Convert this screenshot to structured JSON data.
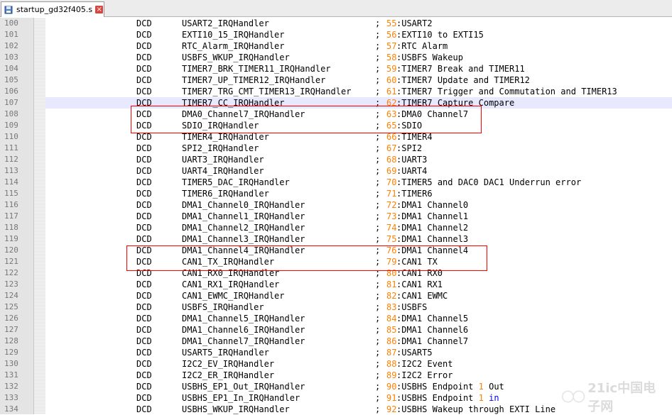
{
  "tab": {
    "filename": "startup_gd32f405.s",
    "icon": "file-icon",
    "close_icon": "close-icon"
  },
  "colors": {
    "accent_number": "#ff8000",
    "keyword": "#0000ff",
    "highlight_box": "#ff0000",
    "current_line": "#e8e8ff"
  },
  "editor": {
    "current_line": "107",
    "rows": [
      {
        "ln": "100",
        "dir": "DCD",
        "handler": "USART2_IRQHandler",
        "semi": ";",
        "num": "55",
        "desc": ":USART2"
      },
      {
        "ln": "101",
        "dir": "DCD",
        "handler": "EXTI10_15_IRQHandler",
        "semi": ";",
        "num": "56",
        "desc": ":EXTI10 to EXTI15"
      },
      {
        "ln": "102",
        "dir": "DCD",
        "handler": "RTC_Alarm_IRQHandler",
        "semi": ";",
        "num": "57",
        "desc": ":RTC Alarm"
      },
      {
        "ln": "103",
        "dir": "DCD",
        "handler": "USBFS_WKUP_IRQHandler",
        "semi": ";",
        "num": "58",
        "desc": ":USBFS Wakeup"
      },
      {
        "ln": "104",
        "dir": "DCD",
        "handler": "TIMER7_BRK_TIMER11_IRQHandler",
        "semi": ";",
        "num": "59",
        "desc": ":TIMER7 Break and TIMER11"
      },
      {
        "ln": "105",
        "dir": "DCD",
        "handler": "TIMER7_UP_TIMER12_IRQHandler",
        "semi": ";",
        "num": "60",
        "desc": ":TIMER7 Update and TIMER12"
      },
      {
        "ln": "106",
        "dir": "DCD",
        "handler": "TIMER7_TRG_CMT_TIMER13_IRQHandler",
        "semi": ";",
        "num": "61",
        "desc": ":TIMER7 Trigger and Commutation and TIMER13"
      },
      {
        "ln": "107",
        "dir": "DCD",
        "handler": "TIMER7_CC_IRQHandler",
        "semi": ";",
        "num": "62",
        "desc": ":TIMER7 Capture Compare"
      },
      {
        "ln": "108",
        "dir": "DCD",
        "handler": "DMA0_Channel7_IRQHandler",
        "semi": ";",
        "num": "63",
        "desc": ":DMA0 Channel7"
      },
      {
        "ln": "109",
        "dir": "DCD",
        "handler": "SDIO_IRQHandler",
        "semi": ";",
        "num": "65",
        "desc": ":SDIO"
      },
      {
        "ln": "110",
        "dir": "DCD",
        "handler": "TIMER4_IRQHandler",
        "semi": ";",
        "num": "66",
        "desc": ":TIMER4"
      },
      {
        "ln": "111",
        "dir": "DCD",
        "handler": "SPI2_IRQHandler",
        "semi": ";",
        "num": "67",
        "desc": ":SPI2"
      },
      {
        "ln": "112",
        "dir": "DCD",
        "handler": "UART3_IRQHandler",
        "semi": ";",
        "num": "68",
        "desc": ":UART3"
      },
      {
        "ln": "113",
        "dir": "DCD",
        "handler": "UART4_IRQHandler",
        "semi": ";",
        "num": "69",
        "desc": ":UART4"
      },
      {
        "ln": "114",
        "dir": "DCD",
        "handler": "TIMER5_DAC_IRQHandler",
        "semi": ";",
        "num": "70",
        "desc": ":TIMER5 and DAC0 DAC1 Underrun error"
      },
      {
        "ln": "115",
        "dir": "DCD",
        "handler": "TIMER6_IRQHandler",
        "semi": ";",
        "num": "71",
        "desc": ":TIMER6"
      },
      {
        "ln": "116",
        "dir": "DCD",
        "handler": "DMA1_Channel0_IRQHandler",
        "semi": ";",
        "num": "72",
        "desc": ":DMA1 Channel0"
      },
      {
        "ln": "117",
        "dir": "DCD",
        "handler": "DMA1_Channel1_IRQHandler",
        "semi": ";",
        "num": "73",
        "desc": ":DMA1 Channel1"
      },
      {
        "ln": "118",
        "dir": "DCD",
        "handler": "DMA1_Channel2_IRQHandler",
        "semi": ";",
        "num": "74",
        "desc": ":DMA1 Channel2"
      },
      {
        "ln": "119",
        "dir": "DCD",
        "handler": "DMA1_Channel3_IRQHandler",
        "semi": ";",
        "num": "75",
        "desc": ":DMA1 Channel3"
      },
      {
        "ln": "120",
        "dir": "DCD",
        "handler": "DMA1_Channel4_IRQHandler",
        "semi": ";",
        "num": "76",
        "desc": ":DMA1 Channel4"
      },
      {
        "ln": "121",
        "dir": "DCD",
        "handler": "CAN1_TX_IRQHandler",
        "semi": ";",
        "num": "79",
        "desc": ":CAN1 TX"
      },
      {
        "ln": "122",
        "dir": "DCD",
        "handler": "CAN1_RX0_IRQHandler",
        "semi": ";",
        "num": "80",
        "desc": ":CAN1 RX0"
      },
      {
        "ln": "123",
        "dir": "DCD",
        "handler": "CAN1_RX1_IRQHandler",
        "semi": ";",
        "num": "81",
        "desc": ":CAN1 RX1"
      },
      {
        "ln": "124",
        "dir": "DCD",
        "handler": "CAN1_EWMC_IRQHandler",
        "semi": ";",
        "num": "82",
        "desc": ":CAN1 EWMC"
      },
      {
        "ln": "125",
        "dir": "DCD",
        "handler": "USBFS_IRQHandler",
        "semi": ";",
        "num": "83",
        "desc": ":USBFS"
      },
      {
        "ln": "126",
        "dir": "DCD",
        "handler": "DMA1_Channel5_IRQHandler",
        "semi": ";",
        "num": "84",
        "desc": ":DMA1 Channel5"
      },
      {
        "ln": "127",
        "dir": "DCD",
        "handler": "DMA1_Channel6_IRQHandler",
        "semi": ";",
        "num": "85",
        "desc": ":DMA1 Channel6"
      },
      {
        "ln": "128",
        "dir": "DCD",
        "handler": "DMA1_Channel7_IRQHandler",
        "semi": ";",
        "num": "86",
        "desc": ":DMA1 Channel7"
      },
      {
        "ln": "129",
        "dir": "DCD",
        "handler": "USART5_IRQHandler",
        "semi": ";",
        "num": "87",
        "desc": ":USART5"
      },
      {
        "ln": "130",
        "dir": "DCD",
        "handler": "I2C2_EV_IRQHandler",
        "semi": ";",
        "num": "88",
        "desc": ":I2C2 Event"
      },
      {
        "ln": "131",
        "dir": "DCD",
        "handler": "I2C2_ER_IRQHandler",
        "semi": ";",
        "num": "89",
        "desc": ":I2C2 Error"
      },
      {
        "ln": "132",
        "dir": "DCD",
        "handler": "USBHS_EP1_Out_IRQHandler",
        "semi": ";",
        "num": "90",
        "desc": ":USBHS Endpoint 1 Out"
      },
      {
        "ln": "133",
        "dir": "DCD",
        "handler": "USBHS_EP1_In_IRQHandler",
        "semi": ";",
        "num": "91",
        "desc": ":USBHS Endpoint 1 in"
      },
      {
        "ln": "134",
        "dir": "DCD",
        "handler": "USBHS_WKUP_IRQHandler",
        "semi": ";",
        "num": "92",
        "desc": ":USBHS Wakeup through EXTI Line"
      }
    ]
  },
  "watermark": {
    "text": "21ic中国电子网"
  }
}
